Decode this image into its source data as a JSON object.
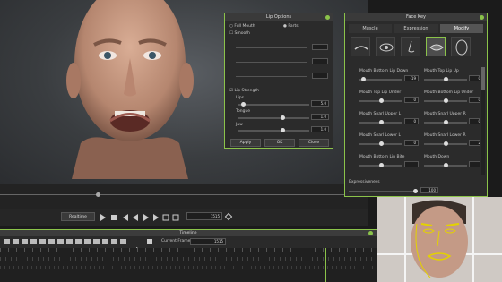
{
  "lip_options": {
    "title": "Lip Options",
    "radio_full_mouth": "Full Mouth",
    "radio_parts": "Parts",
    "smooth_label": "Smooth",
    "lip_strength_label": "Lip Strength",
    "lips_label": "Lips",
    "lips_value": "5.0",
    "tongue_label": "Tongue",
    "tongue_value": "1.0",
    "jaw_label": "Jaw",
    "jaw_value": "1.0",
    "apply_label": "Apply",
    "ok_label": "OK",
    "close_label": "Close"
  },
  "face_key": {
    "title": "Face Key",
    "tabs": [
      "Muscle",
      "Expression",
      "Modify"
    ],
    "active_tab": "Modify",
    "icons": [
      "brow-icon",
      "eye-icon",
      "nose-icon",
      "mouth-icon",
      "head-icon"
    ],
    "sliders": [
      {
        "label": "Mouth Bottom Lip Down",
        "value": "-19"
      },
      {
        "label": "Mouth Top Lip Up",
        "value": "0"
      },
      {
        "label": "Mouth Top Lip Under",
        "value": "0"
      },
      {
        "label": "Mouth Bottom Lip Under",
        "value": "0"
      },
      {
        "label": "Mouth Snarl Upper L",
        "value": "0"
      },
      {
        "label": "Mouth Snarl Upper R",
        "value": "0"
      },
      {
        "label": "Mouth Snarl Lower L",
        "value": "0"
      },
      {
        "label": "Mouth Snarl Lower R",
        "value": "2"
      },
      {
        "label": "Mouth Bottom Lip Bite",
        "value": ""
      },
      {
        "label": "Mouth Down",
        "value": ""
      }
    ],
    "expressiveness_label": "Expressiveness",
    "expressiveness_value": "100"
  },
  "playback": {
    "realtime_label": "Realtime",
    "frame_value": "1515"
  },
  "timeline": {
    "title": "Timeline",
    "current_frame_label": "Current Frame",
    "current_frame_value": "1515"
  },
  "colors": {
    "accent": "#8bc34a",
    "panel_bg": "#2b2b2b",
    "skin": "#c99a82"
  }
}
